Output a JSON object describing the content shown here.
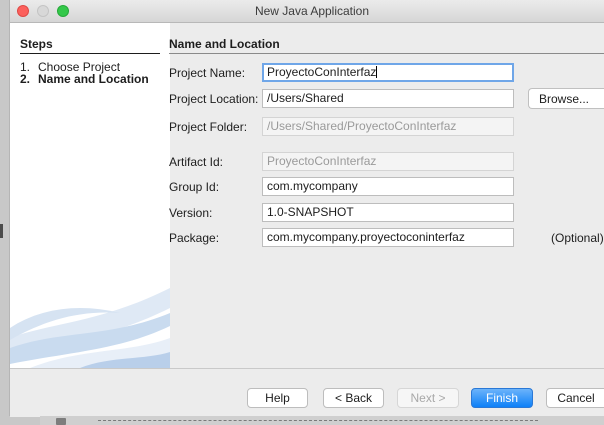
{
  "window": {
    "title": "New Java Application"
  },
  "steps": {
    "heading": "Steps",
    "items": [
      {
        "num": "1.",
        "label": "Choose Project"
      },
      {
        "num": "2.",
        "label": "Name and Location"
      }
    ]
  },
  "panel": {
    "heading": "Name and Location",
    "fields": {
      "project_name": {
        "label": "Project Name:",
        "value": "ProyectoConInterfaz"
      },
      "project_location": {
        "label": "Project Location:",
        "value": "/Users/Shared"
      },
      "project_folder": {
        "label": "Project Folder:",
        "value": "/Users/Shared/ProyectoConInterfaz"
      },
      "artifact_id": {
        "label": "Artifact Id:",
        "value": "ProyectoConInterfaz"
      },
      "group_id": {
        "label": "Group Id:",
        "value": "com.mycompany"
      },
      "version": {
        "label": "Version:",
        "value": "1.0-SNAPSHOT"
      },
      "package": {
        "label": "Package:",
        "value": "com.mycompany.proyectoconinterfaz"
      }
    },
    "browse_label": "Browse...",
    "optional_label": "(Optional)"
  },
  "buttons": {
    "help": "Help",
    "back": "< Back",
    "next": "Next >",
    "finish": "Finish",
    "cancel": "Cancel"
  },
  "colors": {
    "accent": "#0d80f8",
    "focus_ring": "#6fa6e8",
    "close": "#fc605c",
    "zoom": "#34c84a"
  }
}
